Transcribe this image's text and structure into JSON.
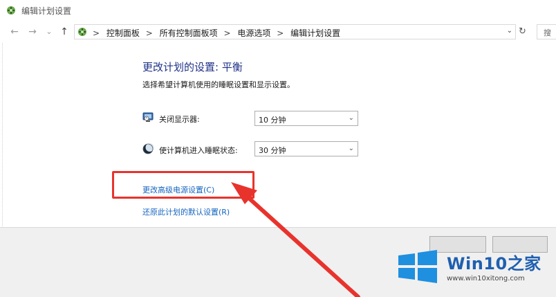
{
  "window": {
    "title": "编辑计划设置",
    "icon": "power-options-icon"
  },
  "nav": {
    "back_icon": "←",
    "forward_icon": "→",
    "recent_icon": "⌄",
    "up_icon": "↑",
    "breadcrumbs": [
      "控制面板",
      "所有控制面板项",
      "电源选项",
      "编辑计划设置"
    ],
    "separator": ">",
    "dropdown_icon": "⌄",
    "refresh_icon": "↻",
    "search_placeholder": "搜索"
  },
  "main": {
    "heading": "更改计划的设置: 平衡",
    "subtitle": "选择希望计算机使用的睡眠设置和显示设置。",
    "settings": [
      {
        "label": "关闭显示器:",
        "value": "10 分钟",
        "icon": "monitor-icon"
      },
      {
        "label": "使计算机进入睡眠状态:",
        "value": "30 分钟",
        "icon": "sleep-moon-icon"
      }
    ],
    "links": {
      "advanced": "更改高级电源设置(C)",
      "restore": "还原此计划的默认设置(R)"
    }
  },
  "watermark": {
    "brand_main": "Win10",
    "brand_suffix": "之家",
    "url": "www.win10xitong.com"
  },
  "colors": {
    "heading": "#1e3287",
    "link": "#1564c0",
    "annotation_red": "#e8332d",
    "brand_blue": "#1f5fb0"
  }
}
